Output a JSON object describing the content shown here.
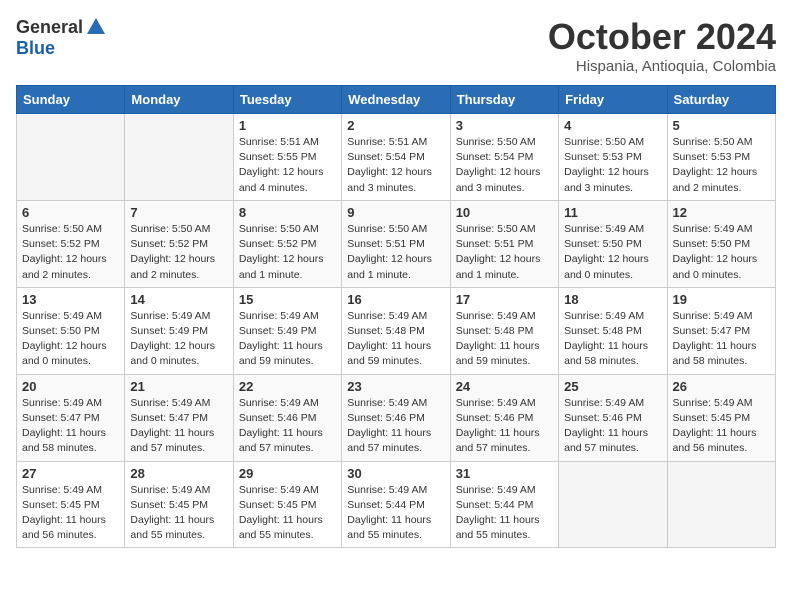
{
  "logo": {
    "general": "General",
    "blue": "Blue"
  },
  "title": "October 2024",
  "subtitle": "Hispania, Antioquia, Colombia",
  "days_of_week": [
    "Sunday",
    "Monday",
    "Tuesday",
    "Wednesday",
    "Thursday",
    "Friday",
    "Saturday"
  ],
  "weeks": [
    [
      {
        "day": "",
        "info": ""
      },
      {
        "day": "",
        "info": ""
      },
      {
        "day": "1",
        "info": "Sunrise: 5:51 AM\nSunset: 5:55 PM\nDaylight: 12 hours and 4 minutes."
      },
      {
        "day": "2",
        "info": "Sunrise: 5:51 AM\nSunset: 5:54 PM\nDaylight: 12 hours and 3 minutes."
      },
      {
        "day": "3",
        "info": "Sunrise: 5:50 AM\nSunset: 5:54 PM\nDaylight: 12 hours and 3 minutes."
      },
      {
        "day": "4",
        "info": "Sunrise: 5:50 AM\nSunset: 5:53 PM\nDaylight: 12 hours and 3 minutes."
      },
      {
        "day": "5",
        "info": "Sunrise: 5:50 AM\nSunset: 5:53 PM\nDaylight: 12 hours and 2 minutes."
      }
    ],
    [
      {
        "day": "6",
        "info": "Sunrise: 5:50 AM\nSunset: 5:52 PM\nDaylight: 12 hours and 2 minutes."
      },
      {
        "day": "7",
        "info": "Sunrise: 5:50 AM\nSunset: 5:52 PM\nDaylight: 12 hours and 2 minutes."
      },
      {
        "day": "8",
        "info": "Sunrise: 5:50 AM\nSunset: 5:52 PM\nDaylight: 12 hours and 1 minute."
      },
      {
        "day": "9",
        "info": "Sunrise: 5:50 AM\nSunset: 5:51 PM\nDaylight: 12 hours and 1 minute."
      },
      {
        "day": "10",
        "info": "Sunrise: 5:50 AM\nSunset: 5:51 PM\nDaylight: 12 hours and 1 minute."
      },
      {
        "day": "11",
        "info": "Sunrise: 5:49 AM\nSunset: 5:50 PM\nDaylight: 12 hours and 0 minutes."
      },
      {
        "day": "12",
        "info": "Sunrise: 5:49 AM\nSunset: 5:50 PM\nDaylight: 12 hours and 0 minutes."
      }
    ],
    [
      {
        "day": "13",
        "info": "Sunrise: 5:49 AM\nSunset: 5:50 PM\nDaylight: 12 hours and 0 minutes."
      },
      {
        "day": "14",
        "info": "Sunrise: 5:49 AM\nSunset: 5:49 PM\nDaylight: 12 hours and 0 minutes."
      },
      {
        "day": "15",
        "info": "Sunrise: 5:49 AM\nSunset: 5:49 PM\nDaylight: 11 hours and 59 minutes."
      },
      {
        "day": "16",
        "info": "Sunrise: 5:49 AM\nSunset: 5:48 PM\nDaylight: 11 hours and 59 minutes."
      },
      {
        "day": "17",
        "info": "Sunrise: 5:49 AM\nSunset: 5:48 PM\nDaylight: 11 hours and 59 minutes."
      },
      {
        "day": "18",
        "info": "Sunrise: 5:49 AM\nSunset: 5:48 PM\nDaylight: 11 hours and 58 minutes."
      },
      {
        "day": "19",
        "info": "Sunrise: 5:49 AM\nSunset: 5:47 PM\nDaylight: 11 hours and 58 minutes."
      }
    ],
    [
      {
        "day": "20",
        "info": "Sunrise: 5:49 AM\nSunset: 5:47 PM\nDaylight: 11 hours and 58 minutes."
      },
      {
        "day": "21",
        "info": "Sunrise: 5:49 AM\nSunset: 5:47 PM\nDaylight: 11 hours and 57 minutes."
      },
      {
        "day": "22",
        "info": "Sunrise: 5:49 AM\nSunset: 5:46 PM\nDaylight: 11 hours and 57 minutes."
      },
      {
        "day": "23",
        "info": "Sunrise: 5:49 AM\nSunset: 5:46 PM\nDaylight: 11 hours and 57 minutes."
      },
      {
        "day": "24",
        "info": "Sunrise: 5:49 AM\nSunset: 5:46 PM\nDaylight: 11 hours and 57 minutes."
      },
      {
        "day": "25",
        "info": "Sunrise: 5:49 AM\nSunset: 5:46 PM\nDaylight: 11 hours and 57 minutes."
      },
      {
        "day": "26",
        "info": "Sunrise: 5:49 AM\nSunset: 5:45 PM\nDaylight: 11 hours and 56 minutes."
      }
    ],
    [
      {
        "day": "27",
        "info": "Sunrise: 5:49 AM\nSunset: 5:45 PM\nDaylight: 11 hours and 56 minutes."
      },
      {
        "day": "28",
        "info": "Sunrise: 5:49 AM\nSunset: 5:45 PM\nDaylight: 11 hours and 55 minutes."
      },
      {
        "day": "29",
        "info": "Sunrise: 5:49 AM\nSunset: 5:45 PM\nDaylight: 11 hours and 55 minutes."
      },
      {
        "day": "30",
        "info": "Sunrise: 5:49 AM\nSunset: 5:44 PM\nDaylight: 11 hours and 55 minutes."
      },
      {
        "day": "31",
        "info": "Sunrise: 5:49 AM\nSunset: 5:44 PM\nDaylight: 11 hours and 55 minutes."
      },
      {
        "day": "",
        "info": ""
      },
      {
        "day": "",
        "info": ""
      }
    ]
  ]
}
